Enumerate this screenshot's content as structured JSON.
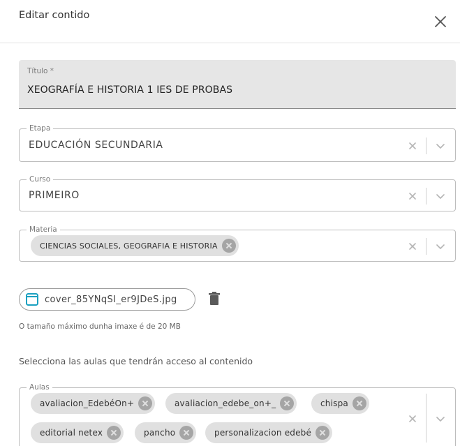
{
  "dialog": {
    "title": "Editar contido"
  },
  "title_field": {
    "label": "Título *",
    "value": "XEOGRAFÍA E HISTORIA 1 IES DE PROBAS"
  },
  "etapa": {
    "label": "Etapa",
    "value": "EDUCACIÓN SECUNDARIA"
  },
  "curso": {
    "label": "Curso",
    "value": "PRIMEIRO"
  },
  "materia": {
    "label": "Materia",
    "chips": [
      "CIENCIAS SOCIALES, GEOGRAFIA E HISTORIA"
    ]
  },
  "file": {
    "name": "cover_85YNqSI_er9JDeS.jpg",
    "hint": "O tamaño máximo dunha imaxe é de 20 MB"
  },
  "aulas_section": {
    "text": "Selecciona las aulas que tendrán acceso al contenido"
  },
  "aulas": {
    "label": "Aulas",
    "chips": [
      "avaliacion_EdebéOn+",
      "avaliacion_edebe_on+_",
      "chispa",
      "editorial netex",
      "pancho",
      "personalizacion edebé"
    ]
  },
  "colors": {
    "accent": "#1aa0c0",
    "chip_bg": "#e0e0e0",
    "field_bg": "#e6e6e6"
  }
}
